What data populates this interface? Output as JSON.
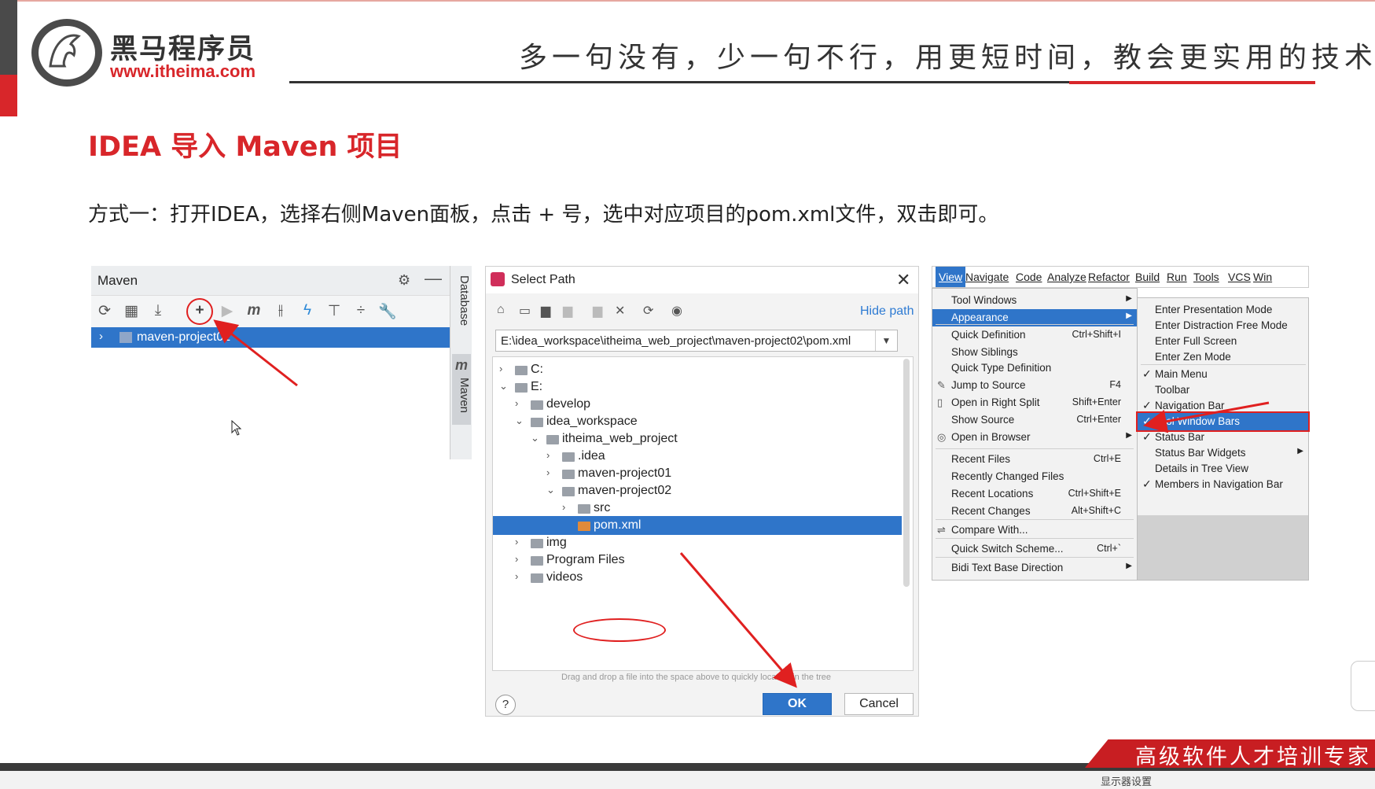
{
  "brand": {
    "name_cn": "黑马程序员",
    "url": "www.itheima.com",
    "slogan": "多一句没有，少一句不行，用更短时间，教会更实用的技术！",
    "footer_tagline": "高级软件人才培训专家",
    "footer_note": "显示器设置"
  },
  "slide": {
    "title": "IDEA 导入 Maven 项目",
    "description": "方式一：打开IDEA，选择右侧Maven面板，点击 + 号，选中对应项目的pom.xml文件，双击即可。"
  },
  "maven_panel": {
    "title": "Maven",
    "project_label": "maven-project01",
    "side_tabs": [
      "Database",
      "Maven"
    ],
    "toolbar_icons": [
      "refresh-icon",
      "add-folder-icon",
      "download-icon",
      "plus-icon",
      "run-icon",
      "maven-m-icon",
      "toggle-offline-icon",
      "lightning-icon",
      "collapse-icon",
      "expand-icon",
      "wrench-icon"
    ]
  },
  "select_path_dialog": {
    "title": "Select Path",
    "hide_path_label": "Hide path",
    "path_value": "E:\\idea_workspace\\itheima_web_project\\maven-project02\\pom.xml",
    "tree": [
      {
        "label": "C:",
        "depth": 0,
        "expanded": false
      },
      {
        "label": "E:",
        "depth": 0,
        "expanded": true
      },
      {
        "label": "develop",
        "depth": 1,
        "expanded": false
      },
      {
        "label": "idea_workspace",
        "depth": 1,
        "expanded": true
      },
      {
        "label": "itheima_web_project",
        "depth": 2,
        "expanded": true
      },
      {
        "label": ".idea",
        "depth": 3,
        "expanded": false
      },
      {
        "label": "maven-project01",
        "depth": 3,
        "expanded": false
      },
      {
        "label": "maven-project02",
        "depth": 3,
        "expanded": true
      },
      {
        "label": "src",
        "depth": 4,
        "expanded": false
      },
      {
        "label": "pom.xml",
        "depth": 4,
        "selected": true
      },
      {
        "label": "img",
        "depth": 1,
        "expanded": false
      },
      {
        "label": "Program Files",
        "depth": 1,
        "expanded": false
      },
      {
        "label": "videos",
        "depth": 1,
        "expanded": false
      }
    ],
    "hint": "Drag and drop a file into the space above to quickly locate it in the tree",
    "help_label": "?",
    "ok_label": "OK",
    "cancel_label": "Cancel"
  },
  "view_menu": {
    "menubar": [
      "View",
      "Navigate",
      "Code",
      "Analyze",
      "Refactor",
      "Build",
      "Run",
      "Tools",
      "VCS",
      "Win"
    ],
    "left_items": [
      {
        "label": "Tool Windows",
        "shortcut": "",
        "submenu": true
      },
      {
        "label": "Appearance",
        "shortcut": "",
        "submenu": true,
        "selected": true
      },
      {
        "label": "Quick Definition",
        "shortcut": "Ctrl+Shift+I"
      },
      {
        "label": "Show Siblings",
        "shortcut": ""
      },
      {
        "label": "Quick Type Definition",
        "shortcut": ""
      },
      {
        "label": "Jump to Source",
        "shortcut": "F4"
      },
      {
        "label": "Open in Right Split",
        "shortcut": "Shift+Enter"
      },
      {
        "label": "Show Source",
        "shortcut": "Ctrl+Enter"
      },
      {
        "label": "Open in Browser",
        "shortcut": "",
        "submenu": true
      },
      {
        "label": "Recent Files",
        "shortcut": "Ctrl+E"
      },
      {
        "label": "Recently Changed Files",
        "shortcut": ""
      },
      {
        "label": "Recent Locations",
        "shortcut": "Ctrl+Shift+E"
      },
      {
        "label": "Recent Changes",
        "shortcut": "Alt+Shift+C"
      },
      {
        "label": "Compare With...",
        "shortcut": ""
      },
      {
        "label": "Quick Switch Scheme...",
        "shortcut": "Ctrl+`"
      },
      {
        "label": "Bidi Text Base Direction",
        "shortcut": "",
        "submenu": true
      }
    ],
    "right_items": [
      {
        "label": "Enter Presentation Mode",
        "checked": false
      },
      {
        "label": "Enter Distraction Free Mode",
        "checked": false
      },
      {
        "label": "Enter Full Screen",
        "checked": false
      },
      {
        "label": "Enter Zen Mode",
        "checked": false
      },
      {
        "label": "Main Menu",
        "checked": true
      },
      {
        "label": "Toolbar",
        "checked": false
      },
      {
        "label": "Navigation Bar",
        "checked": true
      },
      {
        "label": "Tool Window Bars",
        "checked": true,
        "selected": true
      },
      {
        "label": "Status Bar",
        "checked": true
      },
      {
        "label": "Status Bar Widgets",
        "checked": false,
        "submenu": true
      },
      {
        "label": "Details in Tree View",
        "checked": false
      },
      {
        "label": "Members in Navigation Bar",
        "checked": true
      }
    ]
  },
  "colors": {
    "brand_red": "#d8262a",
    "selection_blue": "#2f75c9",
    "annotation_red": "#e02020"
  }
}
